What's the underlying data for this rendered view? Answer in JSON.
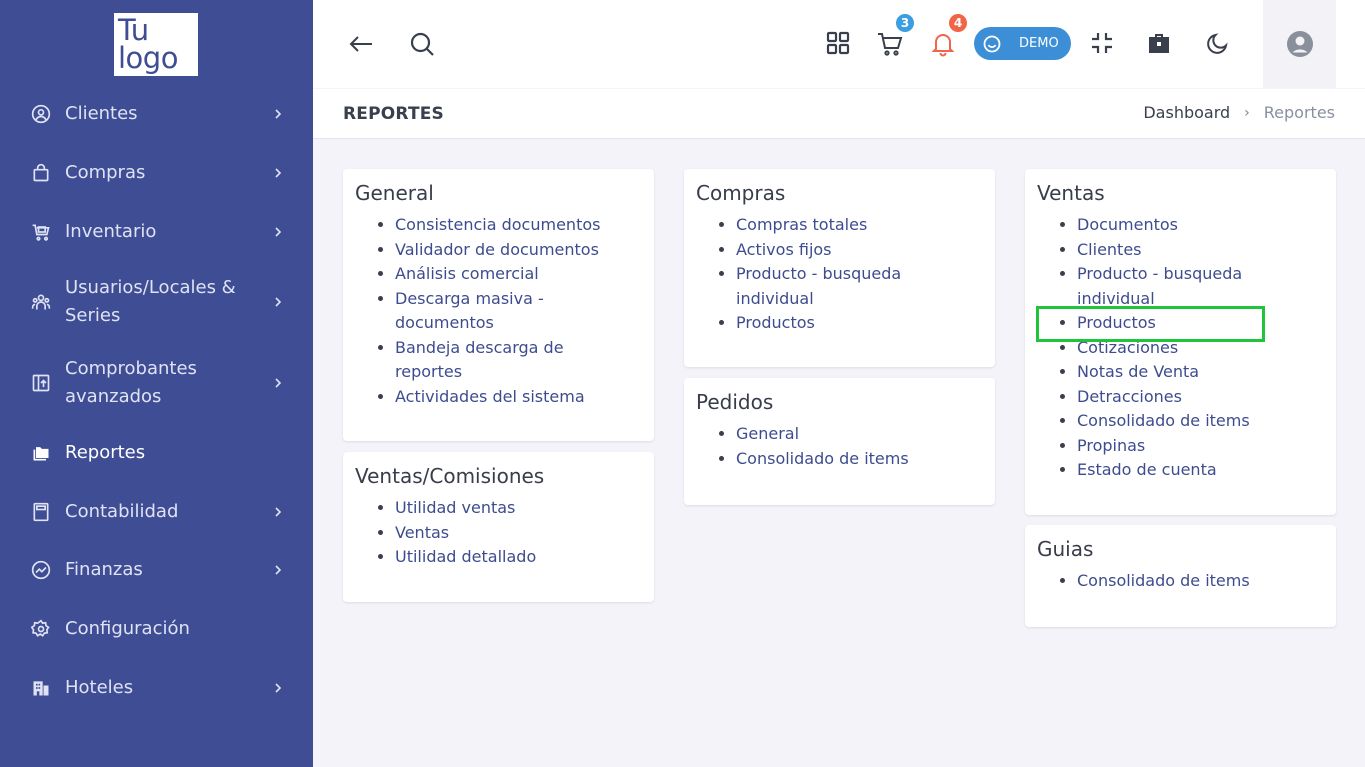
{
  "logo": {
    "line1": "Tu",
    "line2": "logo"
  },
  "sidebar": {
    "items": [
      {
        "label": "Clientes",
        "icon": "user-circle-icon"
      },
      {
        "label": "Compras",
        "icon": "shopping-bag-icon"
      },
      {
        "label": "Inventario",
        "icon": "cart-icon"
      },
      {
        "label": "Usuarios/Locales & Series",
        "icon": "users-icon"
      },
      {
        "label": "Comprobantes avanzados",
        "icon": "document-upload-icon"
      },
      {
        "label": "Reportes",
        "icon": "folders-icon"
      },
      {
        "label": "Contabilidad",
        "icon": "calculator-icon"
      },
      {
        "label": "Finanzas",
        "icon": "chart-circle-icon"
      },
      {
        "label": "Configuración",
        "icon": "gear-icon"
      },
      {
        "label": "Hoteles",
        "icon": "building-icon"
      }
    ]
  },
  "topbar": {
    "cart_count": "3",
    "notifications_count": "4",
    "demo_label": "DEMO",
    "colors": {
      "cart_badge": "#3c9ee0",
      "notif_badge": "#f06548",
      "demo_bg": "#3c8fd6"
    }
  },
  "page": {
    "title": "REPORTES"
  },
  "breadcrumb": {
    "home": "Dashboard",
    "current": "Reportes"
  },
  "cards": {
    "general": {
      "title": "General",
      "items": [
        "Consistencia documentos",
        "Validador de documentos",
        "Análisis comercial",
        "Descarga masiva - documentos",
        "Bandeja descarga de reportes",
        "Actividades del sistema"
      ]
    },
    "ventas_comisiones": {
      "title": "Ventas/Comisiones",
      "items": [
        "Utilidad ventas",
        "Ventas",
        "Utilidad detallado"
      ]
    },
    "compras": {
      "title": "Compras",
      "items": [
        "Compras totales",
        "Activos fijos",
        "Producto - busqueda individual",
        "Productos"
      ]
    },
    "pedidos": {
      "title": "Pedidos",
      "items": [
        "General",
        "Consolidado de items"
      ]
    },
    "ventas": {
      "title": "Ventas",
      "items": [
        "Documentos",
        "Clientes",
        "Producto - busqueda individual",
        "Productos",
        "Cotizaciones",
        "Notas de Venta",
        "Detracciones",
        "Consolidado de items",
        "Propinas",
        "Estado de cuenta"
      ]
    },
    "guias": {
      "title": "Guias",
      "items": [
        "Consolidado de items"
      ]
    }
  }
}
